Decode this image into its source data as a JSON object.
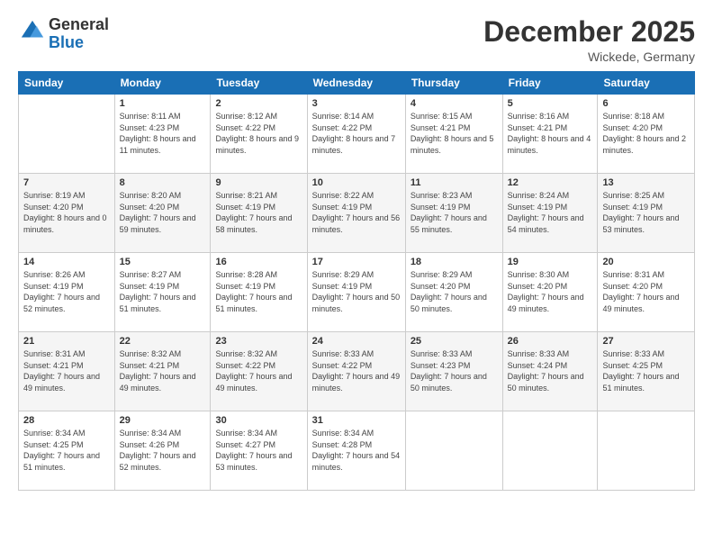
{
  "header": {
    "logo_general": "General",
    "logo_blue": "Blue",
    "month_title": "December 2025",
    "location": "Wickede, Germany"
  },
  "days_of_week": [
    "Sunday",
    "Monday",
    "Tuesday",
    "Wednesday",
    "Thursday",
    "Friday",
    "Saturday"
  ],
  "weeks": [
    [
      {
        "day": "",
        "sunrise": "",
        "sunset": "",
        "daylight": ""
      },
      {
        "day": "1",
        "sunrise": "Sunrise: 8:11 AM",
        "sunset": "Sunset: 4:23 PM",
        "daylight": "Daylight: 8 hours and 11 minutes."
      },
      {
        "day": "2",
        "sunrise": "Sunrise: 8:12 AM",
        "sunset": "Sunset: 4:22 PM",
        "daylight": "Daylight: 8 hours and 9 minutes."
      },
      {
        "day": "3",
        "sunrise": "Sunrise: 8:14 AM",
        "sunset": "Sunset: 4:22 PM",
        "daylight": "Daylight: 8 hours and 7 minutes."
      },
      {
        "day": "4",
        "sunrise": "Sunrise: 8:15 AM",
        "sunset": "Sunset: 4:21 PM",
        "daylight": "Daylight: 8 hours and 5 minutes."
      },
      {
        "day": "5",
        "sunrise": "Sunrise: 8:16 AM",
        "sunset": "Sunset: 4:21 PM",
        "daylight": "Daylight: 8 hours and 4 minutes."
      },
      {
        "day": "6",
        "sunrise": "Sunrise: 8:18 AM",
        "sunset": "Sunset: 4:20 PM",
        "daylight": "Daylight: 8 hours and 2 minutes."
      }
    ],
    [
      {
        "day": "7",
        "sunrise": "Sunrise: 8:19 AM",
        "sunset": "Sunset: 4:20 PM",
        "daylight": "Daylight: 8 hours and 0 minutes."
      },
      {
        "day": "8",
        "sunrise": "Sunrise: 8:20 AM",
        "sunset": "Sunset: 4:20 PM",
        "daylight": "Daylight: 7 hours and 59 minutes."
      },
      {
        "day": "9",
        "sunrise": "Sunrise: 8:21 AM",
        "sunset": "Sunset: 4:19 PM",
        "daylight": "Daylight: 7 hours and 58 minutes."
      },
      {
        "day": "10",
        "sunrise": "Sunrise: 8:22 AM",
        "sunset": "Sunset: 4:19 PM",
        "daylight": "Daylight: 7 hours and 56 minutes."
      },
      {
        "day": "11",
        "sunrise": "Sunrise: 8:23 AM",
        "sunset": "Sunset: 4:19 PM",
        "daylight": "Daylight: 7 hours and 55 minutes."
      },
      {
        "day": "12",
        "sunrise": "Sunrise: 8:24 AM",
        "sunset": "Sunset: 4:19 PM",
        "daylight": "Daylight: 7 hours and 54 minutes."
      },
      {
        "day": "13",
        "sunrise": "Sunrise: 8:25 AM",
        "sunset": "Sunset: 4:19 PM",
        "daylight": "Daylight: 7 hours and 53 minutes."
      }
    ],
    [
      {
        "day": "14",
        "sunrise": "Sunrise: 8:26 AM",
        "sunset": "Sunset: 4:19 PM",
        "daylight": "Daylight: 7 hours and 52 minutes."
      },
      {
        "day": "15",
        "sunrise": "Sunrise: 8:27 AM",
        "sunset": "Sunset: 4:19 PM",
        "daylight": "Daylight: 7 hours and 51 minutes."
      },
      {
        "day": "16",
        "sunrise": "Sunrise: 8:28 AM",
        "sunset": "Sunset: 4:19 PM",
        "daylight": "Daylight: 7 hours and 51 minutes."
      },
      {
        "day": "17",
        "sunrise": "Sunrise: 8:29 AM",
        "sunset": "Sunset: 4:19 PM",
        "daylight": "Daylight: 7 hours and 50 minutes."
      },
      {
        "day": "18",
        "sunrise": "Sunrise: 8:29 AM",
        "sunset": "Sunset: 4:20 PM",
        "daylight": "Daylight: 7 hours and 50 minutes."
      },
      {
        "day": "19",
        "sunrise": "Sunrise: 8:30 AM",
        "sunset": "Sunset: 4:20 PM",
        "daylight": "Daylight: 7 hours and 49 minutes."
      },
      {
        "day": "20",
        "sunrise": "Sunrise: 8:31 AM",
        "sunset": "Sunset: 4:20 PM",
        "daylight": "Daylight: 7 hours and 49 minutes."
      }
    ],
    [
      {
        "day": "21",
        "sunrise": "Sunrise: 8:31 AM",
        "sunset": "Sunset: 4:21 PM",
        "daylight": "Daylight: 7 hours and 49 minutes."
      },
      {
        "day": "22",
        "sunrise": "Sunrise: 8:32 AM",
        "sunset": "Sunset: 4:21 PM",
        "daylight": "Daylight: 7 hours and 49 minutes."
      },
      {
        "day": "23",
        "sunrise": "Sunrise: 8:32 AM",
        "sunset": "Sunset: 4:22 PM",
        "daylight": "Daylight: 7 hours and 49 minutes."
      },
      {
        "day": "24",
        "sunrise": "Sunrise: 8:33 AM",
        "sunset": "Sunset: 4:22 PM",
        "daylight": "Daylight: 7 hours and 49 minutes."
      },
      {
        "day": "25",
        "sunrise": "Sunrise: 8:33 AM",
        "sunset": "Sunset: 4:23 PM",
        "daylight": "Daylight: 7 hours and 50 minutes."
      },
      {
        "day": "26",
        "sunrise": "Sunrise: 8:33 AM",
        "sunset": "Sunset: 4:24 PM",
        "daylight": "Daylight: 7 hours and 50 minutes."
      },
      {
        "day": "27",
        "sunrise": "Sunrise: 8:33 AM",
        "sunset": "Sunset: 4:25 PM",
        "daylight": "Daylight: 7 hours and 51 minutes."
      }
    ],
    [
      {
        "day": "28",
        "sunrise": "Sunrise: 8:34 AM",
        "sunset": "Sunset: 4:25 PM",
        "daylight": "Daylight: 7 hours and 51 minutes."
      },
      {
        "day": "29",
        "sunrise": "Sunrise: 8:34 AM",
        "sunset": "Sunset: 4:26 PM",
        "daylight": "Daylight: 7 hours and 52 minutes."
      },
      {
        "day": "30",
        "sunrise": "Sunrise: 8:34 AM",
        "sunset": "Sunset: 4:27 PM",
        "daylight": "Daylight: 7 hours and 53 minutes."
      },
      {
        "day": "31",
        "sunrise": "Sunrise: 8:34 AM",
        "sunset": "Sunset: 4:28 PM",
        "daylight": "Daylight: 7 hours and 54 minutes."
      },
      {
        "day": "",
        "sunrise": "",
        "sunset": "",
        "daylight": ""
      },
      {
        "day": "",
        "sunrise": "",
        "sunset": "",
        "daylight": ""
      },
      {
        "day": "",
        "sunrise": "",
        "sunset": "",
        "daylight": ""
      }
    ]
  ]
}
